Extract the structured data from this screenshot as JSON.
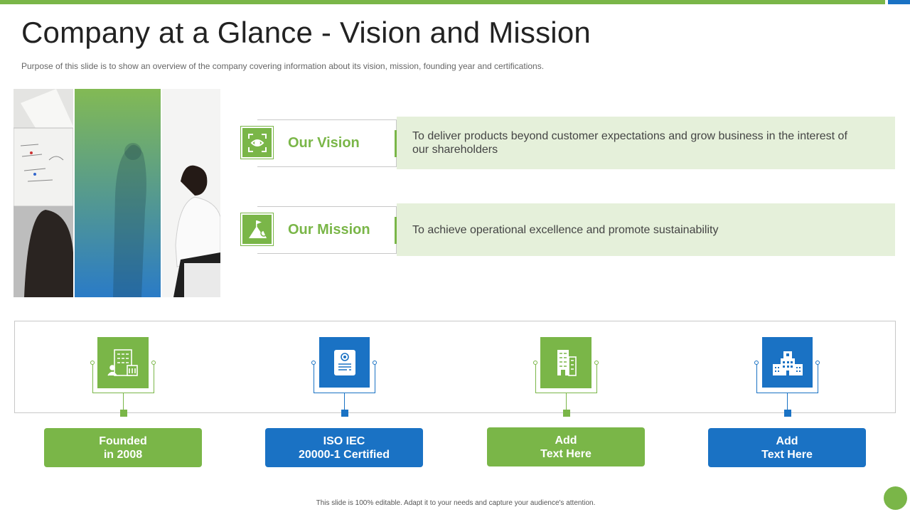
{
  "slide": {
    "title": "Company at a Glance - Vision and Mission",
    "subtitle": "Purpose of this slide is to show an overview of the company covering information about its vision, mission, founding year and certifications.",
    "footer": "This slide is 100% editable.  Adapt it to your needs and capture your audience's attention."
  },
  "colors": {
    "green": "#7ab648",
    "blue": "#1a72c4",
    "light_green": "#e5f0da"
  },
  "vision": {
    "label": "Our Vision",
    "icon": "eye-target-icon",
    "text": "To deliver products beyond customer expectations and grow business in the interest of our shareholders"
  },
  "mission": {
    "label": "Our Mission",
    "icon": "mountain-flag-icon",
    "text": "To achieve operational excellence and promote sustainability"
  },
  "milestones": [
    {
      "line1": "Founded",
      "line2": "in 2008",
      "icon": "office-building-icon",
      "color": "green"
    },
    {
      "line1": "ISO IEC",
      "line2": "20000-1 Certified",
      "icon": "certificate-icon",
      "color": "blue"
    },
    {
      "line1": "Add",
      "line2": "Text Here",
      "icon": "apartment-building-icon",
      "color": "green"
    },
    {
      "line1": "Add",
      "line2": "Text Here",
      "icon": "hospital-building-icon",
      "color": "blue"
    }
  ]
}
